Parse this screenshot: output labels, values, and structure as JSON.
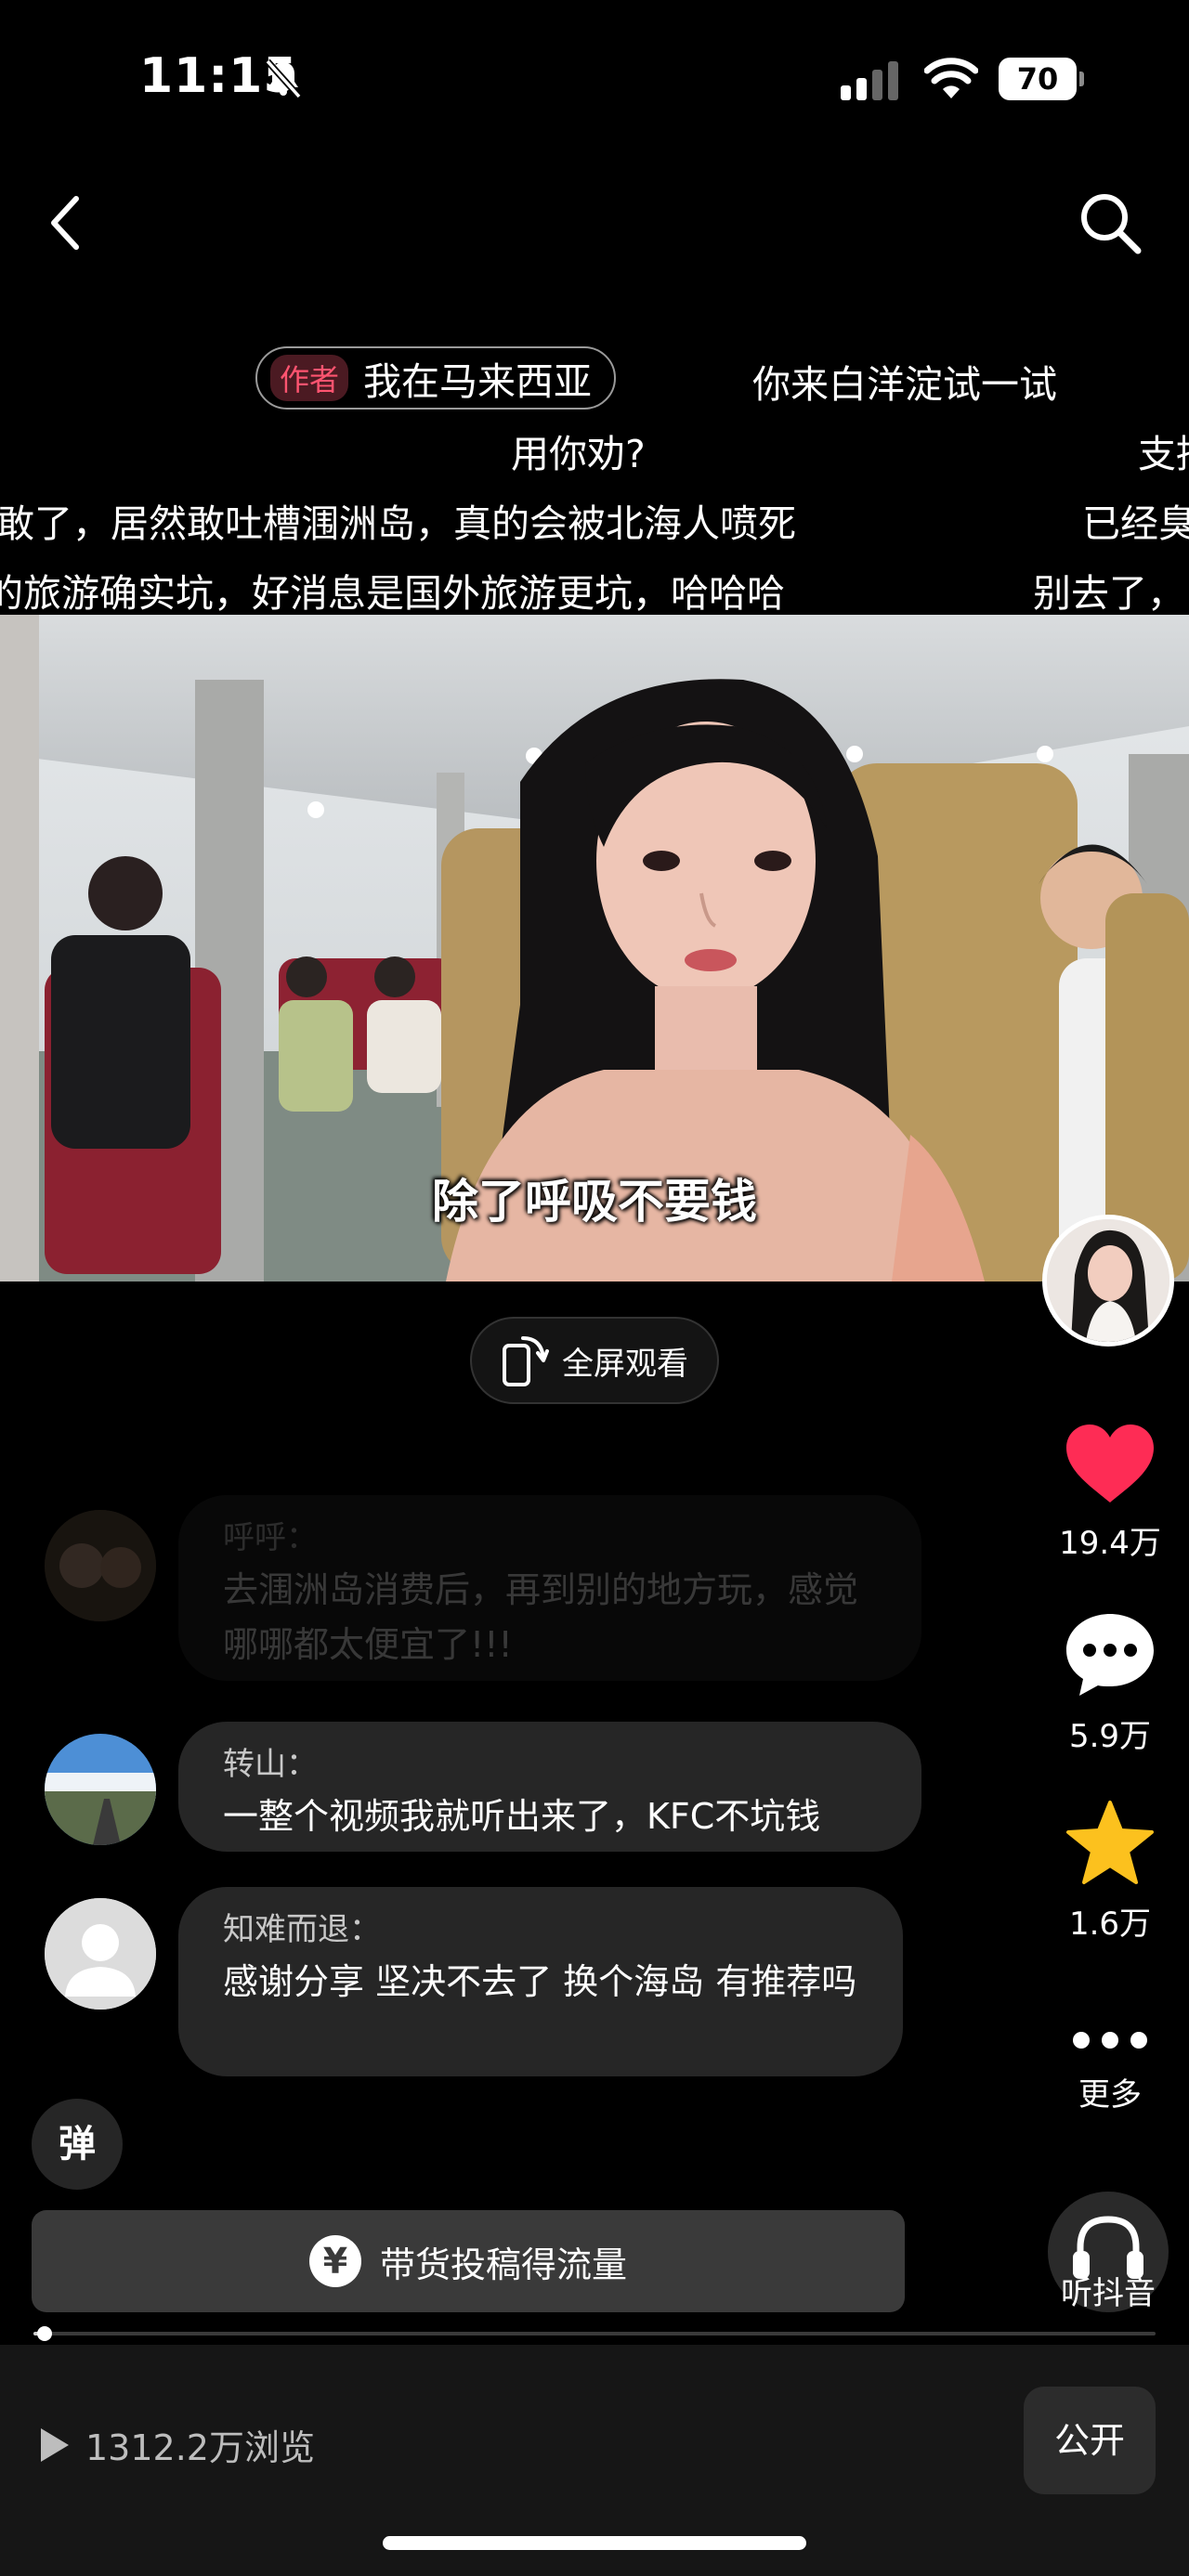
{
  "status_bar": {
    "time": "11:15",
    "battery": "70"
  },
  "danmaku": {
    "author_tag": "作者",
    "author_text": "我在马来西亚",
    "line1_right": "你来白洋淀试一试",
    "line2_center": "用你劝?",
    "line2_right": "支持",
    "line3_left": "敢了，居然敢吐槽涠洲岛，真的会被北海人喷死",
    "line3_right": "已经臭",
    "line4_left": "的旅游确实坑，好消息是国外旅游更坑，哈哈哈",
    "line4_right": "别去了，"
  },
  "video": {
    "subtitle": "除了呼吸不要钱"
  },
  "fullscreen_label": "全屏观看",
  "rail": {
    "likes": "19.4万",
    "comments": "5.9万",
    "favorites": "1.6万",
    "more": "更多",
    "listen": "听抖音",
    "like_color": "#fe2c55",
    "star_color": "#fcc11e"
  },
  "comments": [
    {
      "name": "呼呼：",
      "text": "去涠洲岛消费后，再到别的地方玩，感觉哪哪都太便宜了!!!"
    },
    {
      "name": "转山：",
      "text": "一整个视频我就听出来了，KFC不坑钱"
    },
    {
      "name": "知难而退：",
      "text": "感谢分享  坚决不去了  换个海岛  有推荐吗"
    }
  ],
  "danmaku_toggle": "弹",
  "promo": {
    "icon": "¥",
    "label": "带货投稿得流量"
  },
  "progress": 0.01,
  "footer": {
    "views": "1312.2万浏览",
    "public": "公开"
  }
}
